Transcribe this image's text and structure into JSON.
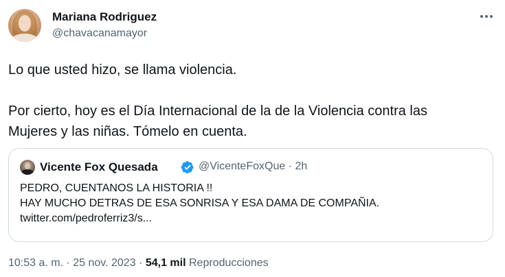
{
  "author": {
    "name": "Mariana Rodriguez",
    "handle": "@chavacanamayor"
  },
  "tweet": {
    "paragraph1": "Lo que usted hizo, se llama violencia.",
    "paragraph2_line1": "Por cierto, hoy es el Día Internacional de la de la Violencia contra las",
    "paragraph2_line2": "Mujeres y las niñas. Tómelo en cuenta."
  },
  "quoted": {
    "name": "Vicente Fox Quesada",
    "handle_time": "@VicenteFoxQue · 2h",
    "line1": "PEDRO, CUENTANOS LA HISTORIA !!",
    "line2": "HAY MUCHO DETRAS DE ESA SONRISA Y ESA DAMA DE COMPAÑIA.",
    "line3": "twitter.com/pedroferriz3/s..."
  },
  "meta": {
    "time_date": "10:53 a. m. · 25 nov. 2023 · ",
    "views_count": "54,1 mil",
    "views_label": "Reproducciones"
  },
  "icons": {
    "more": "more-horizontal-icon",
    "verified": "verified-badge-icon"
  },
  "colors": {
    "verified": "#1d9bf0",
    "secondary_text": "#536471",
    "border": "#cfd9de"
  }
}
